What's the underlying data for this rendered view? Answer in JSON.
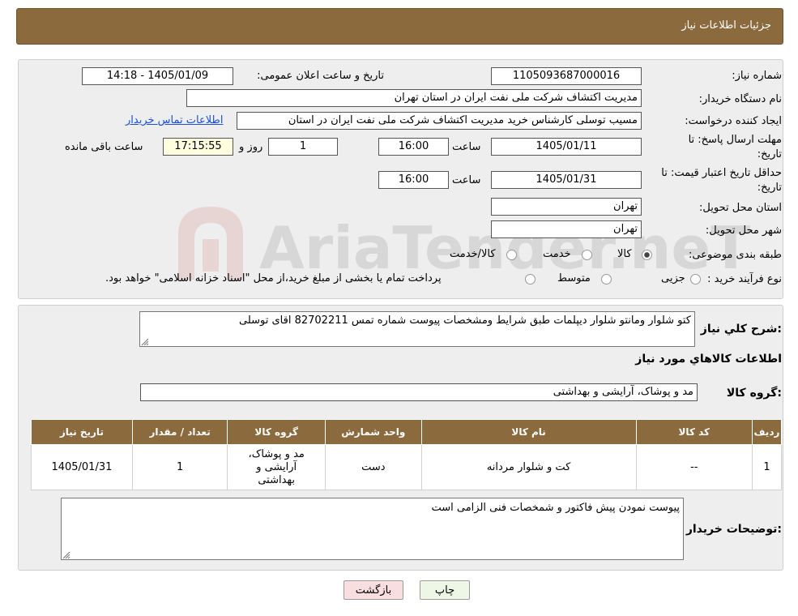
{
  "header": {
    "title": "جزئیات اطلاعات نیاز"
  },
  "watermark": {
    "text": "AriaTender.neT"
  },
  "form": {
    "need_number": {
      "label": "شماره نیاز:",
      "value": "1105093687000016"
    },
    "announce_datetime": {
      "label": "تاریخ و ساعت اعلان عمومی:",
      "value": "1405/01/09 - 14:18"
    },
    "buyer_org": {
      "label": "نام دستگاه خریدار:",
      "value": "مدیریت اکتشاف شرکت ملی نفت ایران در استان تهران"
    },
    "requester": {
      "label": "ایجاد کننده درخواست:",
      "value": "مسیب توسلی کارشناس خرید مدیریت اکتشاف شرکت ملی نفت ایران در استان",
      "contact_link": "اطلاعات تماس خریدار"
    },
    "reply_deadline": {
      "label_line1": "مهلت ارسال پاسخ: تا",
      "label_line2": "تاریخ:",
      "date": "1405/01/11",
      "time_label": "ساعت",
      "time": "16:00",
      "days": "1",
      "days_label": "روز و",
      "remaining": "17:15:55",
      "remaining_label": "ساعت باقی مانده"
    },
    "price_validity": {
      "label_line1": "حداقل تاریخ اعتبار قیمت: تا",
      "label_line2": "تاریخ:",
      "date": "1405/01/31",
      "time_label": "ساعت",
      "time": "16:00"
    },
    "province": {
      "label": "استان محل تحویل:",
      "value": "تهران"
    },
    "city": {
      "label": "شهر محل تحویل:",
      "value": "تهران"
    },
    "category": {
      "label": "طبقه بندی موضوعی:",
      "options": [
        {
          "label": "کالا",
          "selected": true
        },
        {
          "label": "خدمت",
          "selected": false
        },
        {
          "label": "کالا/خدمت",
          "selected": false
        }
      ]
    },
    "purchase_type": {
      "label": "نوع فرآیند خرید :",
      "options": [
        {
          "label": "جزیی",
          "selected": false
        },
        {
          "label": "متوسط",
          "selected": false
        }
      ],
      "note": "پرداخت تمام یا بخشی از مبلغ خرید،از محل \"اسناد خزانه اسلامی\" خواهد بود."
    }
  },
  "description": {
    "label": "شرح کلي نياز:",
    "value": "کتو شلوار  ومانتو شلوار  دیپلمات طبق شرایط  ومشخصات پیوست  شماره تمس  82702211 اقای توسلی"
  },
  "items_section": {
    "title": "اطلاعات کالاهاي مورد نياز",
    "group_label": "گروه کالا:",
    "group_value": "مد و پوشاک، آرایشی و بهداشتی",
    "table": {
      "headers": [
        "ردیف",
        "کد کالا",
        "نام کالا",
        "واحد شمارش",
        "گروه کالا",
        "تعداد / مقدار",
        "تاریخ نیاز"
      ],
      "rows": [
        [
          "1",
          "--",
          "کت و شلوار مردانه",
          "دست",
          "مد و پوشاک، آرایشی و بهداشتی",
          "1",
          "1405/01/31"
        ]
      ]
    }
  },
  "buyer_notes": {
    "label": "توضیحات خریدار:",
    "value": "پیوست نمودن پیش فاکتور و شمخصات فنی الزامی است"
  },
  "buttons": {
    "print": "چاپ",
    "back": "بازگشت"
  }
}
